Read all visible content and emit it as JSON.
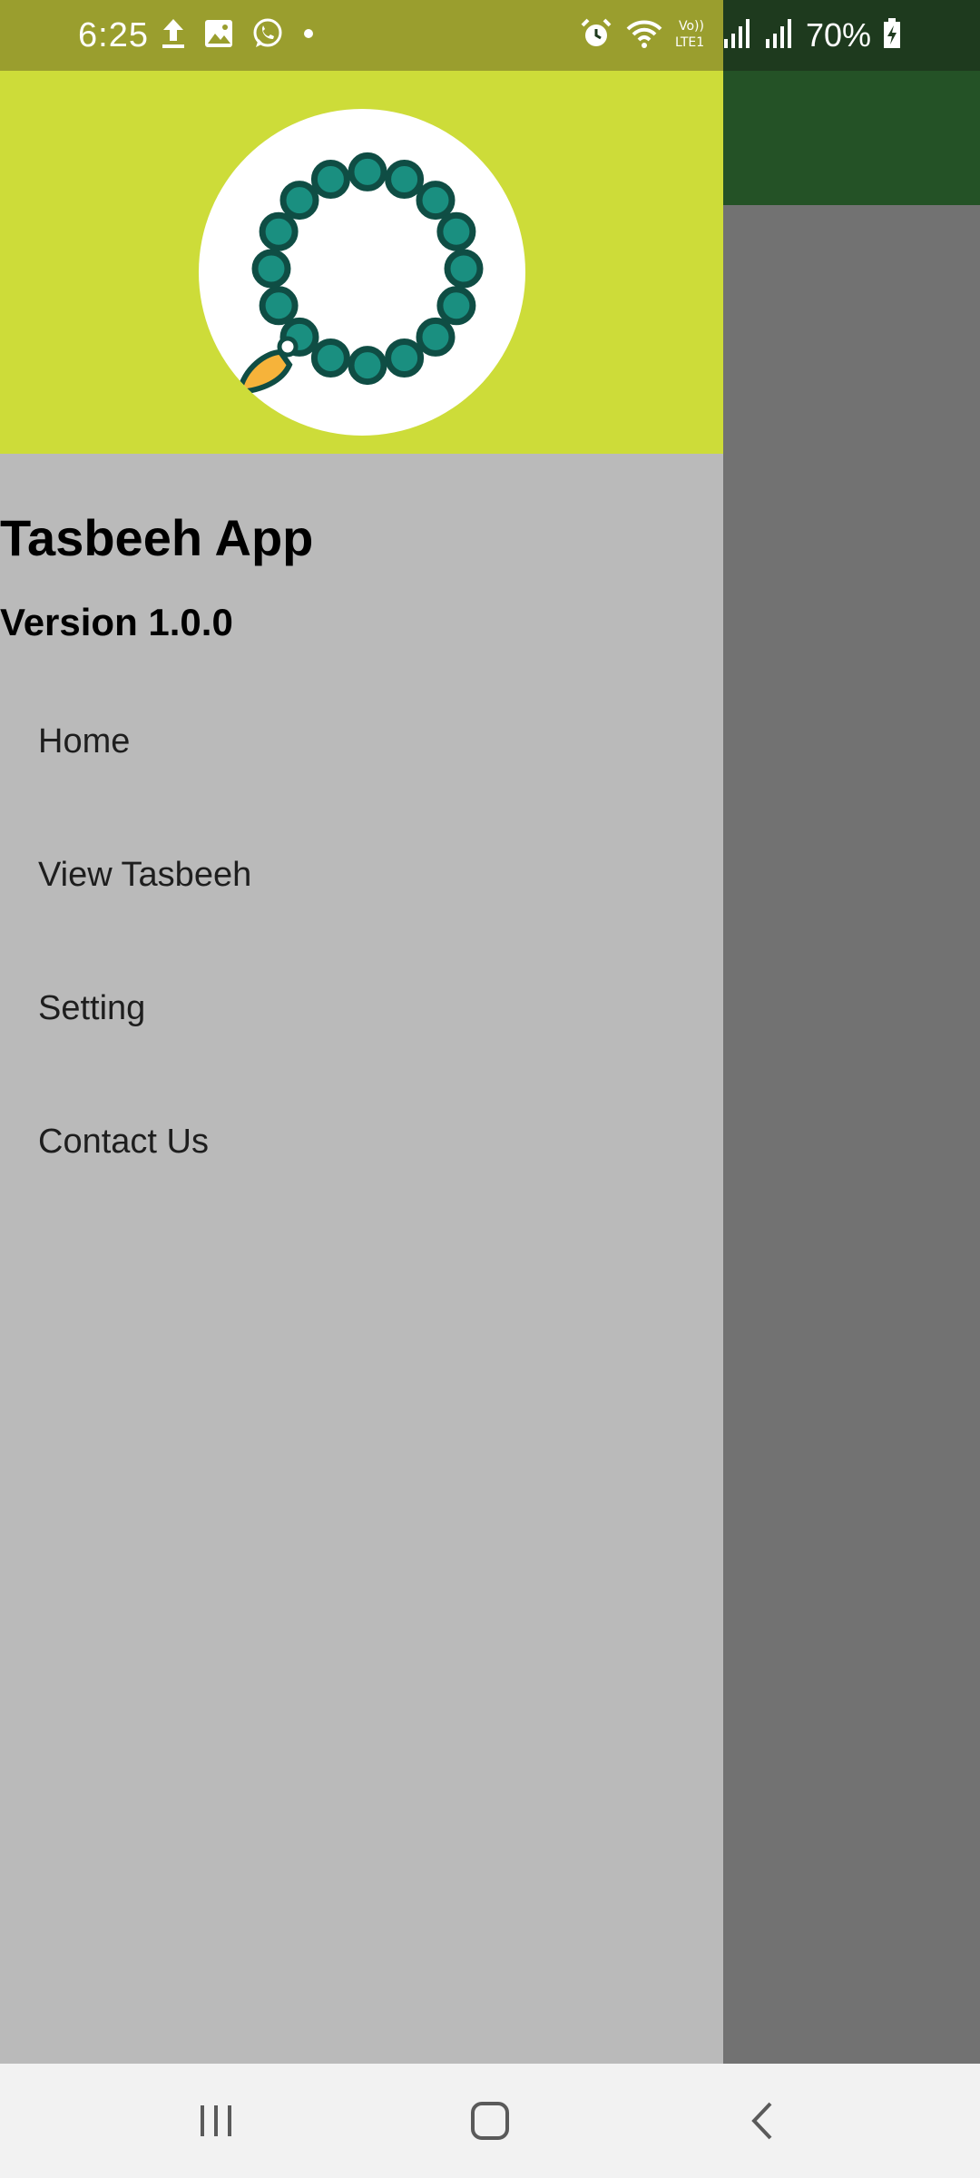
{
  "status_bar": {
    "time": "6:25",
    "battery": "70%",
    "left_icons": [
      "upload-icon",
      "gallery-icon",
      "whatsapp-icon",
      "dot-icon"
    ],
    "right_icons": [
      "alarm-icon",
      "wifi-icon",
      "volte-icon",
      "signal-icon",
      "signal-icon",
      "battery-charging-icon"
    ],
    "volte_label": "Vo))\nLTE1"
  },
  "drawer": {
    "header_color": "#cddc39",
    "title": "Tasbeeh App",
    "version": "Version 1.0.0",
    "items": [
      {
        "label": "Home"
      },
      {
        "label": "View Tasbeeh"
      },
      {
        "label": "Setting"
      },
      {
        "label": "Contact Us"
      }
    ]
  },
  "app_bar": {
    "color": "#245226"
  },
  "colors": {
    "bead_fill": "#1a8f80",
    "bead_stroke": "#0f4d44",
    "tassel": "#f6b33a"
  },
  "nav_bar": {
    "buttons": [
      "recent-apps-icon",
      "home-icon",
      "back-icon"
    ]
  }
}
